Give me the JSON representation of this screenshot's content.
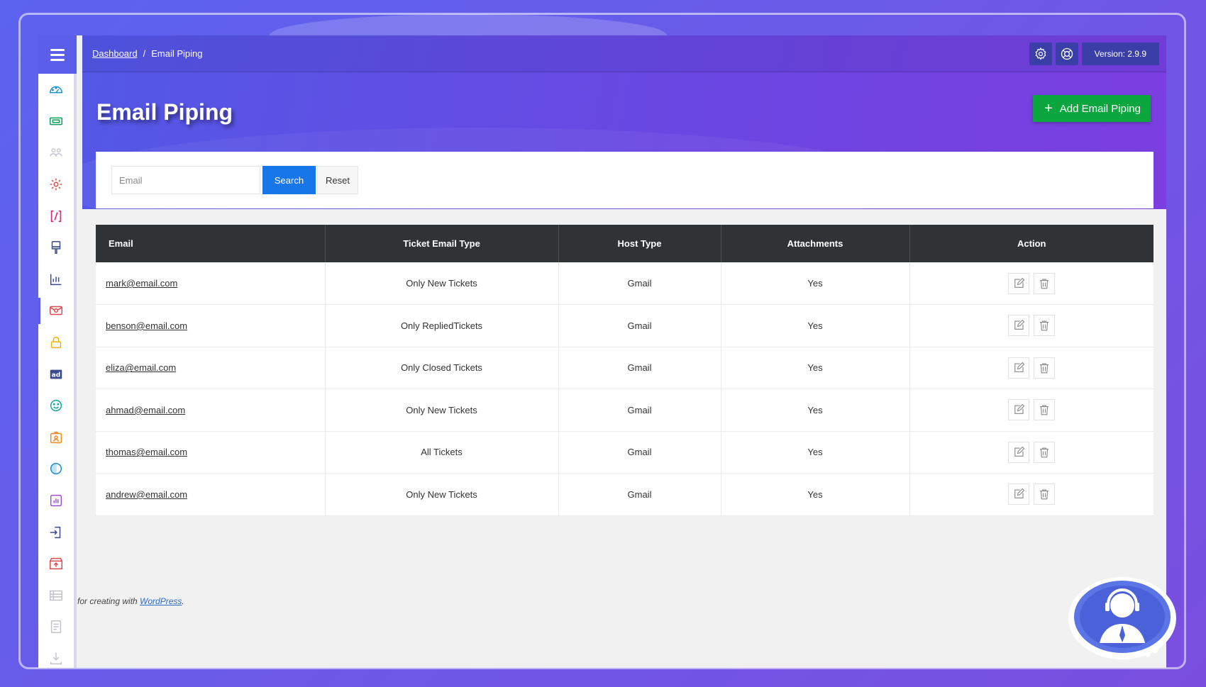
{
  "breadcrumb": {
    "home": "Dashboard",
    "separator": "/",
    "current": "Email Piping"
  },
  "topbar": {
    "version": "Version: 2.9.9",
    "icons": [
      "gear-icon",
      "lifebuoy-icon"
    ]
  },
  "page": {
    "title": "Email Piping",
    "add_button": "Add Email Piping"
  },
  "search": {
    "placeholder": "Email",
    "search_label": "Search",
    "reset_label": "Reset"
  },
  "table": {
    "headers": [
      "Email",
      "Ticket Email Type",
      "Host Type",
      "Attachments",
      "Action"
    ],
    "rows": [
      {
        "email": "mark@email.com",
        "type": "Only New Tickets",
        "host": "Gmail",
        "attachments": "Yes"
      },
      {
        "email": "benson@email.com",
        "type": "Only RepliedTickets",
        "host": "Gmail",
        "attachments": "Yes"
      },
      {
        "email": "eliza@email.com",
        "type": "Only Closed Tickets",
        "host": "Gmail",
        "attachments": "Yes"
      },
      {
        "email": "ahmad@email.com",
        "type": "Only New Tickets",
        "host": "Gmail",
        "attachments": "Yes"
      },
      {
        "email": "thomas@email.com",
        "type": "All Tickets",
        "host": "Gmail",
        "attachments": "Yes"
      },
      {
        "email": "andrew@email.com",
        "type": "Only New Tickets",
        "host": "Gmail",
        "attachments": "Yes"
      }
    ]
  },
  "footer": {
    "text": "for creating with ",
    "link": "WordPress",
    "suffix": "."
  },
  "sidebar": {
    "icons": [
      "dashboard-icon",
      "ticket-icon",
      "users-icon",
      "settings-icon",
      "code-icon",
      "paint-icon",
      "chart-icon",
      "email-icon",
      "lock-icon",
      "ad-icon",
      "smiley-icon",
      "id-card-icon",
      "theme-icon",
      "report-icon",
      "import-icon",
      "archive-icon",
      "table-icon",
      "document-icon",
      "download-icon"
    ],
    "active": "email-icon"
  },
  "colors": {
    "accent": "#5a5ee8",
    "add_button": "#0ca63f",
    "search_button": "#1777e8",
    "table_header": "#2f3336"
  }
}
